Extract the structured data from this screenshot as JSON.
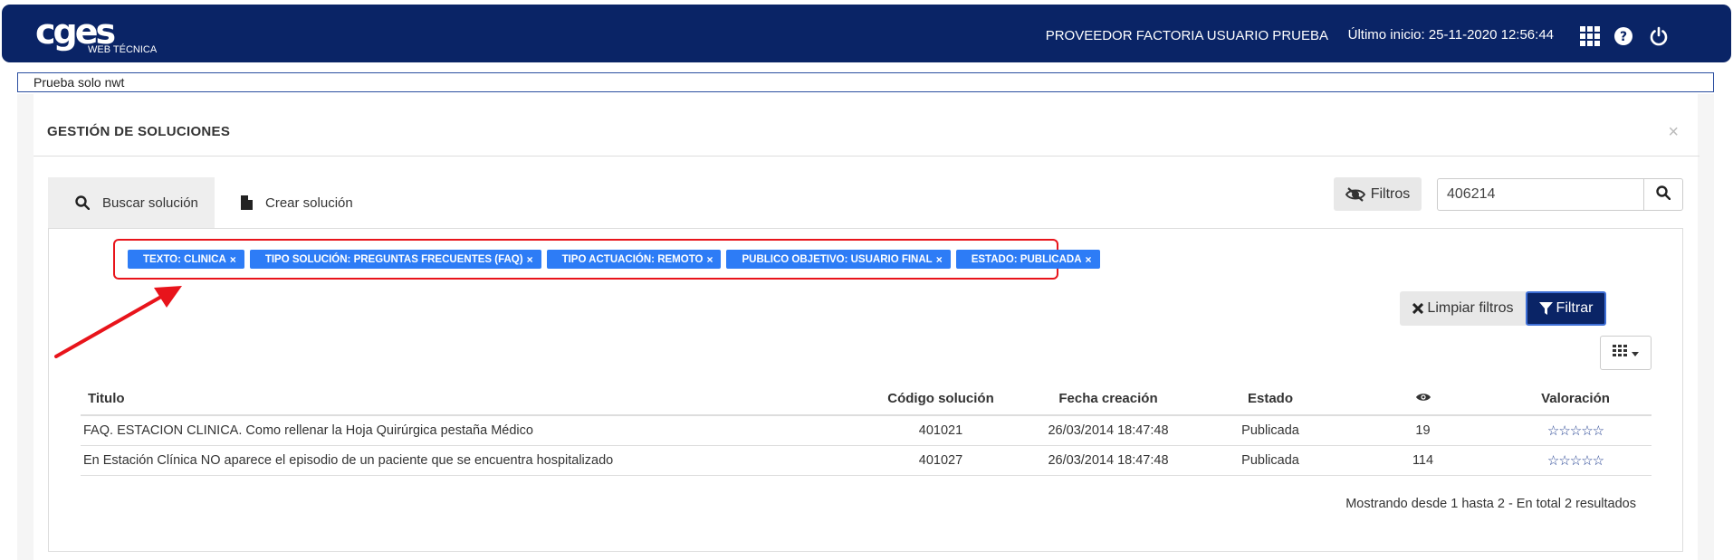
{
  "header": {
    "logo_text": "cges",
    "logo_subtitle": "WEB TÉCNICA",
    "user_name": "PROVEEDOR FACTORIA USUARIO PRUEBA",
    "last_login": "Último inicio: 25-11-2020 12:56:44",
    "icons": [
      "apps-grid-icon",
      "help-icon",
      "power-icon"
    ]
  },
  "notice": "Prueba solo nwt",
  "panel": {
    "title": "GESTIÓN DE SOLUCIONES",
    "close": "×"
  },
  "tabs": [
    {
      "label": "Buscar solución",
      "icon": "search-icon"
    },
    {
      "label": "Crear solución",
      "icon": "file-icon"
    }
  ],
  "toolbar": {
    "filters_label": "Filtros",
    "search_value": "406214"
  },
  "active_filters": [
    "TEXTO: CLINICA",
    "TIPO SOLUCIÓN: PREGUNTAS FRECUENTES (FAQ)",
    "TIPO ACTUACIÓN: REMOTO",
    "PUBLICO OBJETIVO: USUARIO FINAL",
    "ESTADO: PUBLICADA"
  ],
  "actions": {
    "clear_label": "Limpiar filtros",
    "filter_label": "Filtrar"
  },
  "table": {
    "headers": {
      "title": "Titulo",
      "code": "Código solución",
      "date": "Fecha creación",
      "state": "Estado",
      "rating": "Valoración"
    },
    "rows": [
      {
        "title": "FAQ. ESTACION CLINICA. Como rellenar la Hoja Quirúrgica pestaña Médico",
        "code": "401021",
        "date": "26/03/2014 18:47:48",
        "state": "Publicada",
        "views": "19",
        "stars": "☆☆☆☆☆"
      },
      {
        "title": "En Estación Clínica NO aparece el episodio de un paciente que se encuentra hospitalizado",
        "code": "401027",
        "date": "26/03/2014 18:47:48",
        "state": "Publicada",
        "views": "114",
        "stars": "☆☆☆☆☆"
      }
    ]
  },
  "results_text": "Mostrando desde 1 hasta 2 - En total 2 resultados",
  "colors": {
    "navy": "#0a2466",
    "chip_blue": "#2d7cf6",
    "highlight_red": "#e8141b"
  }
}
